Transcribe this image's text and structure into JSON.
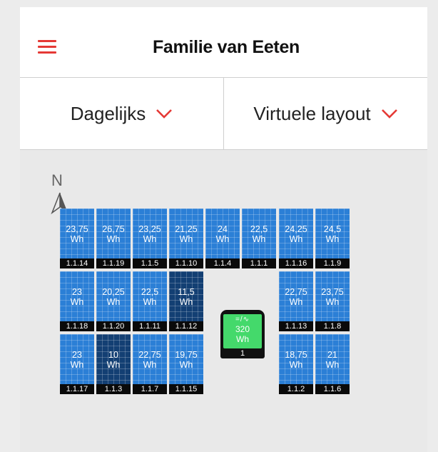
{
  "header": {
    "title": "Familie van Eeten"
  },
  "toolbar": {
    "period": "Dagelijks",
    "view": "Virtuele layout"
  },
  "compass": {
    "label": "N"
  },
  "colors": {
    "accent": "#e53935",
    "panel": "#2b7fd6",
    "panel_low": "#133f73",
    "inverter": "#44d96b"
  },
  "panels": [
    {
      "id": "1.1.14",
      "value": "23,75",
      "unit": "Wh",
      "low": false
    },
    {
      "id": "1.1.19",
      "value": "26,75",
      "unit": "Wh",
      "low": false
    },
    {
      "id": "1.1.5",
      "value": "23,25",
      "unit": "Wh",
      "low": false
    },
    {
      "id": "1.1.10",
      "value": "21,25",
      "unit": "Wh",
      "low": false
    },
    {
      "id": "1.1.4",
      "value": "24",
      "unit": "Wh",
      "low": false
    },
    {
      "id": "1.1.1",
      "value": "22,5",
      "unit": "Wh",
      "low": false
    },
    {
      "id": "1.1.16",
      "value": "24,25",
      "unit": "Wh",
      "low": false
    },
    {
      "id": "1.1.9",
      "value": "24,5",
      "unit": "Wh",
      "low": false
    },
    {
      "id": "1.1.18",
      "value": "23",
      "unit": "Wh",
      "low": false
    },
    {
      "id": "1.1.20",
      "value": "20,25",
      "unit": "Wh",
      "low": false
    },
    {
      "id": "1.1.11",
      "value": "22,5",
      "unit": "Wh",
      "low": false
    },
    {
      "id": "1.1.12",
      "value": "11,5",
      "unit": "Wh",
      "low": true
    },
    {
      "id": "1.1.13",
      "value": "22,75",
      "unit": "Wh",
      "low": false
    },
    {
      "id": "1.1.8",
      "value": "23,75",
      "unit": "Wh",
      "low": false
    },
    {
      "id": "1.1.17",
      "value": "23",
      "unit": "Wh",
      "low": false
    },
    {
      "id": "1.1.3",
      "value": "10",
      "unit": "Wh",
      "low": true
    },
    {
      "id": "1.1.7",
      "value": "22,75",
      "unit": "Wh",
      "low": false
    },
    {
      "id": "1.1.15",
      "value": "19,75",
      "unit": "Wh",
      "low": false
    },
    {
      "id": "1.1.2",
      "value": "18,75",
      "unit": "Wh",
      "low": false
    },
    {
      "id": "1.1.6",
      "value": "21",
      "unit": "Wh",
      "low": false
    }
  ],
  "inverter": {
    "symbol": "=/∿",
    "value": "320",
    "unit": "Wh",
    "id": "1"
  }
}
